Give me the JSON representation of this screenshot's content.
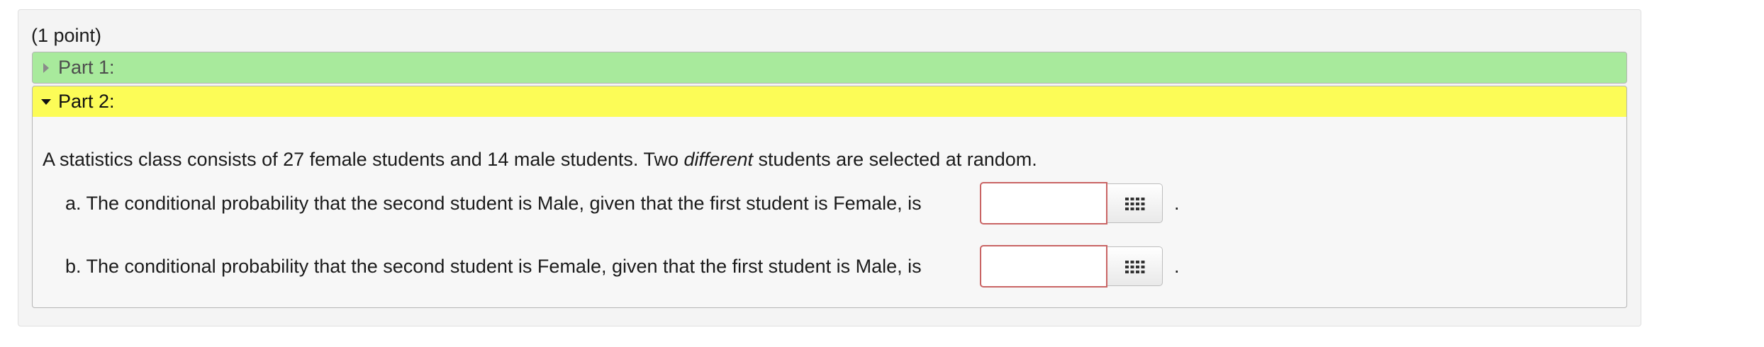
{
  "problem": {
    "points": "(1 point)",
    "parts": [
      {
        "label": "Part 1:",
        "state": "collapsed",
        "color": "#a8ea9c"
      },
      {
        "label": "Part 2:",
        "state": "expanded",
        "color": "#fcfc57"
      }
    ],
    "statement": {
      "before": "A statistics class consists of 27 female students and 14 male students. Two ",
      "emphasis": "different",
      "after": " students are selected at random."
    },
    "questions": [
      {
        "text": "a. The conditional probability that the second student is Male, given that the first student is Female, is",
        "value": "",
        "suffix": ".",
        "keypad_icon": "keypad-grid-icon"
      },
      {
        "text": "b. The conditional probability that the second student is Female, given that the first student is Male, is",
        "value": "",
        "suffix": ".",
        "keypad_icon": "keypad-grid-icon"
      }
    ]
  },
  "colors": {
    "invalid_border": "#c96464",
    "panel_bg": "#f4f4f4"
  }
}
